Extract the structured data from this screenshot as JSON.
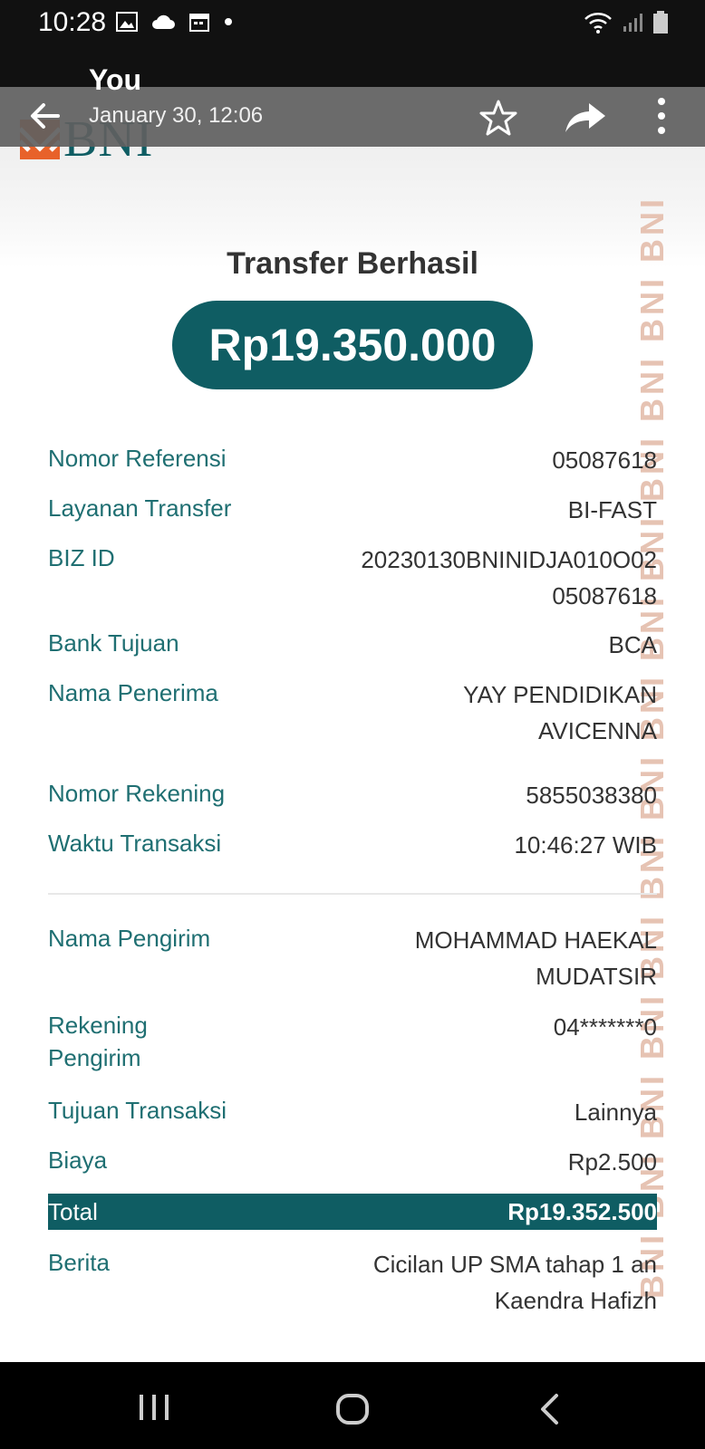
{
  "status_bar": {
    "time": "10:28"
  },
  "app_bar": {
    "sender": "You",
    "date": "January 30, 12:06"
  },
  "logo": {
    "text": "BNI"
  },
  "watermark": {
    "text": "BNI BNI BNI BNI BNI BNI BNI BNI BNI BNI BNI BNI BNI BNI"
  },
  "receipt": {
    "title": "Transfer Berhasil",
    "amount": "Rp19.350.000",
    "details": [
      {
        "label": "Nomor Referensi",
        "value": "05087618"
      },
      {
        "label": "Layanan Transfer",
        "value": "BI-FAST"
      },
      {
        "label": "BIZ ID",
        "value_line1": "20230130BNINIDJA010O02",
        "value_line2": "05087618"
      },
      {
        "label": "Bank Tujuan",
        "value": "BCA"
      },
      {
        "label": "Nama Penerima",
        "value_line1": "YAY PENDIDIKAN",
        "value_line2": "AVICENNA"
      },
      {
        "label": "Nomor Rekening",
        "value": "5855038380"
      },
      {
        "label": "Waktu Transaksi",
        "value": "10:46:27 WIB"
      }
    ],
    "sender_details": [
      {
        "label": "Nama Pengirim",
        "value_line1": "MOHAMMAD HAEKAL",
        "value_line2": "MUDATSIR"
      },
      {
        "label_line1": "Rekening",
        "label_line2": "Pengirim",
        "value": "04*******0"
      },
      {
        "label": "Tujuan Transaksi",
        "value": "Lainnya"
      },
      {
        "label": "Biaya",
        "value": "Rp2.500"
      }
    ],
    "total": {
      "label": "Total",
      "value": "Rp19.352.500"
    },
    "berita": {
      "label": "Berita",
      "value_line1": "Cicilan UP SMA tahap 1 an",
      "value_line2": "Kaendra Hafizh"
    }
  },
  "colors": {
    "brand_teal": "#0f5d63",
    "label_teal": "#1f6f72",
    "brand_orange": "#e8622a"
  }
}
